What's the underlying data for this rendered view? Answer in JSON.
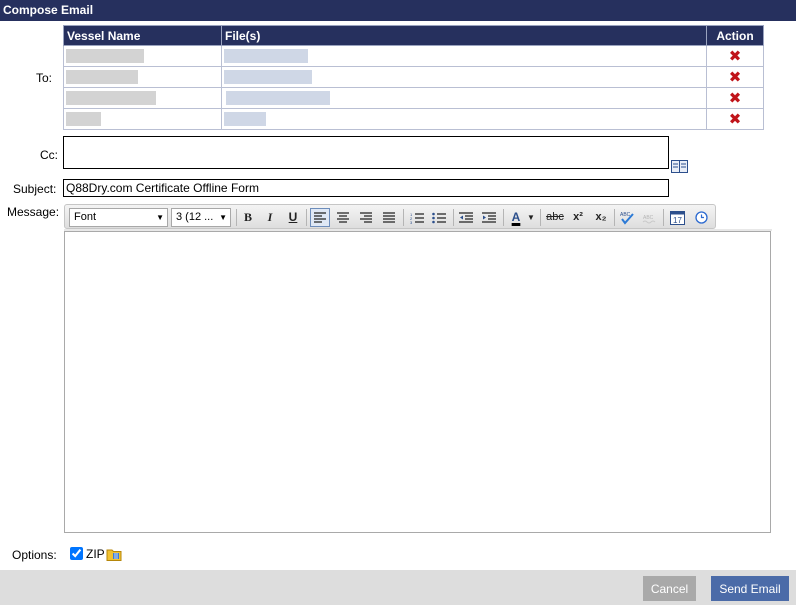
{
  "window": {
    "title": "Compose Email"
  },
  "labels": {
    "to": "To:",
    "cc": "Cc:",
    "subject": "Subject:",
    "message": "Message:",
    "options": "Options:"
  },
  "recipients_table": {
    "headers": {
      "vessel": "Vessel Name",
      "files": "File(s)",
      "action": "Action"
    },
    "rows": [
      {
        "vessel": "",
        "files": "",
        "action_icon": "delete-x-icon"
      },
      {
        "vessel": "",
        "files": "",
        "action_icon": "delete-x-icon"
      },
      {
        "vessel": "",
        "files": "",
        "action_icon": "delete-x-icon"
      },
      {
        "vessel": "",
        "files": "",
        "action_icon": "delete-x-icon"
      }
    ]
  },
  "cc": {
    "value": "",
    "address_book_icon": "address-book-icon"
  },
  "subject": {
    "value": "Q88Dry.com Certificate Offline Form"
  },
  "editor": {
    "font_select": "Font",
    "size_select": "3 (12 ...",
    "buttons": {
      "bold": "B",
      "italic": "I",
      "underline": "U",
      "strike": "abc",
      "superscript": "x²",
      "subscript": "x₂",
      "font_color": "A"
    },
    "body": ""
  },
  "options": {
    "zip_label": "ZIP",
    "zip_checked": true
  },
  "footer": {
    "cancel": "Cancel",
    "send": "Send Email"
  },
  "colors": {
    "header_bg": "#26305e",
    "send_button": "#4b6ba8",
    "cancel_button": "#a9a9a9",
    "delete_icon": "#c0141a"
  }
}
